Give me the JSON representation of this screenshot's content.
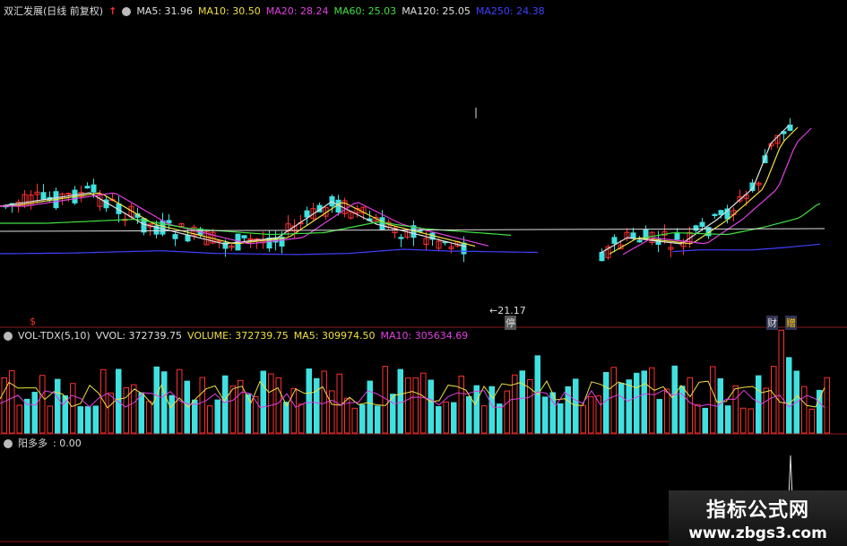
{
  "price_legend": {
    "title": "双汇发展(日线 前复权)",
    "items": [
      {
        "text": "MA5: 31.96",
        "color": "#e0e0e0"
      },
      {
        "text": "MA10: 30.50",
        "color": "#f0e040"
      },
      {
        "text": "MA20: 28.24",
        "color": "#e040e0"
      },
      {
        "text": "MA60: 25.03",
        "color": "#40e040"
      },
      {
        "text": "MA120: 25.05",
        "color": "#e0e0e0"
      },
      {
        "text": "MA250: 24.38",
        "color": "#4040ff"
      }
    ]
  },
  "vol_legend": {
    "title": "VOL-TDX(5,10)",
    "items": [
      {
        "text": "VVOL: 372739.75",
        "color": "#e0e0e0"
      },
      {
        "text": "VOLUME: 372739.75",
        "color": "#f0e040"
      },
      {
        "text": "MA5: 309974.50",
        "color": "#f0e040"
      },
      {
        "text": "MA10: 305634.69",
        "color": "#e040e0"
      }
    ]
  },
  "ind_legend": {
    "title": "阳多多",
    "value": ": 0.00"
  },
  "annotations": {
    "low_price": "←21.17",
    "ting_marker": "停",
    "cai_marker": "财",
    "zeng_marker": "赠",
    "dollar_marker": "$"
  },
  "watermark": {
    "title": "指标公式网",
    "url": "www.zbgs3.com"
  },
  "colors": {
    "up": "#ff3030",
    "down": "#40e0e0",
    "pane_border": "#8b1a1a"
  }
}
